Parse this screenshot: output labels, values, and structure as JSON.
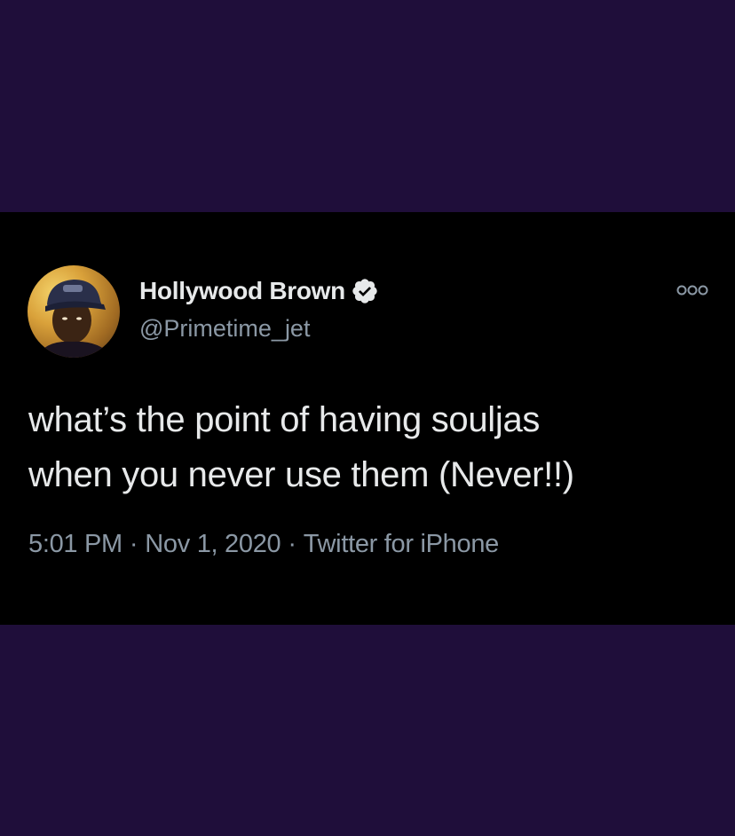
{
  "tweet": {
    "display_name": "Hollywood Brown",
    "handle": "@Primetime_jet",
    "verified": true,
    "text_lines": [
      "what’s the point of having souljas",
      "when you never use them (Never!!)"
    ],
    "time": "5:01 PM",
    "date": "Nov 1, 2020",
    "source": "Twitter for iPhone",
    "separator": "·"
  },
  "colors": {
    "background": "#1f0e3a",
    "card": "#000000",
    "primary_text": "#e7e9ea",
    "secondary_text": "#8b98a5"
  },
  "icons": {
    "verified": "verified-badge-icon",
    "more": "more-options-icon"
  }
}
